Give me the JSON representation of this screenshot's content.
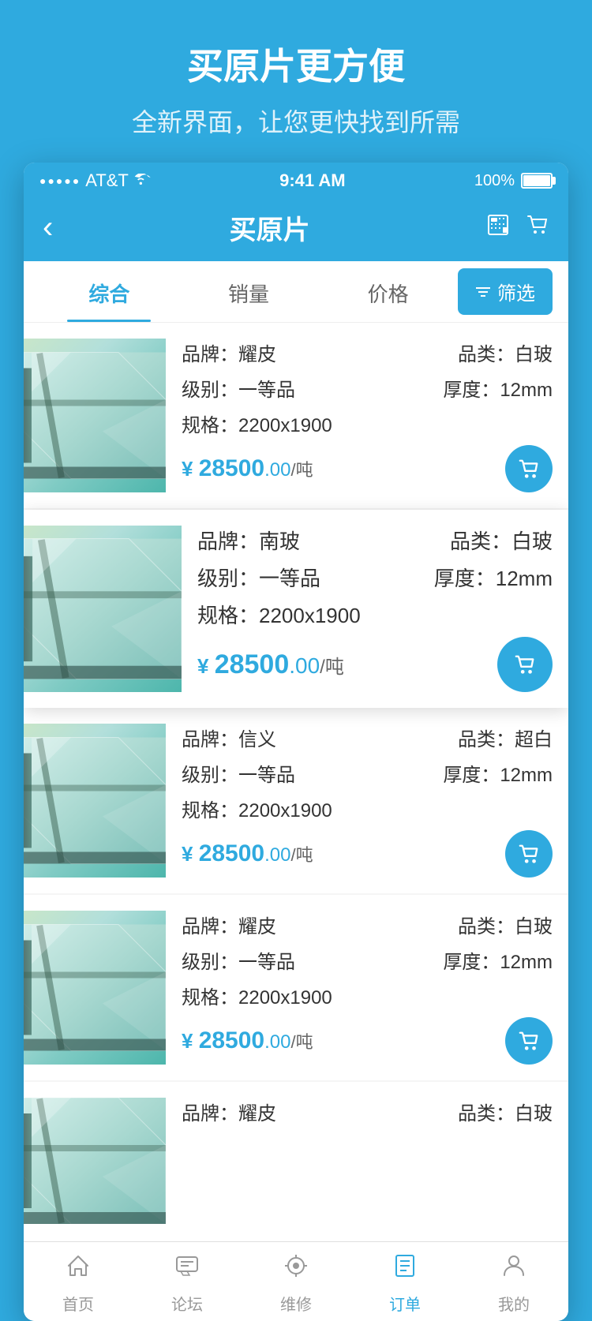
{
  "promo": {
    "title": "买原片更方便",
    "subtitle": "全新界面，让您更快找到所需"
  },
  "statusBar": {
    "carrier": "AT&T",
    "wifi": "wifi",
    "time": "9:41 AM",
    "battery": "100%"
  },
  "navBar": {
    "title": "买原片",
    "backLabel": "‹"
  },
  "tabs": [
    {
      "id": "comprehensive",
      "label": "综合",
      "active": true
    },
    {
      "id": "sales",
      "label": "销量",
      "active": false
    },
    {
      "id": "price",
      "label": "价格",
      "active": false
    }
  ],
  "filterBtn": "筛选",
  "products": [
    {
      "id": 1,
      "brand_label": "品牌：",
      "brand": "耀皮",
      "category_label": "品类：",
      "category": "白玻",
      "grade_label": "级别：",
      "grade": "一等品",
      "thickness_label": "厚度：",
      "thickness": "12mm",
      "spec_label": "规格：",
      "spec": "2200x1900",
      "price_symbol": "¥",
      "price_main": "28500",
      "price_cents": ".00",
      "price_unit": "/吨",
      "highlighted": false
    },
    {
      "id": 2,
      "brand_label": "品牌：",
      "brand": "南玻",
      "category_label": "品类：",
      "category": "白玻",
      "grade_label": "级别：",
      "grade": "一等品",
      "thickness_label": "厚度：",
      "thickness": "12mm",
      "spec_label": "规格：",
      "spec": "2200x1900",
      "price_symbol": "¥",
      "price_main": "28500",
      "price_cents": ".00",
      "price_unit": "/吨",
      "highlighted": true
    },
    {
      "id": 3,
      "brand_label": "品牌：",
      "brand": "信义",
      "category_label": "品类：",
      "category": "超白",
      "grade_label": "级别：",
      "grade": "一等品",
      "thickness_label": "厚度：",
      "thickness": "12mm",
      "spec_label": "规格：",
      "spec": "2200x1900",
      "price_symbol": "¥",
      "price_main": "28500",
      "price_cents": ".00",
      "price_unit": "/吨",
      "highlighted": false
    },
    {
      "id": 4,
      "brand_label": "品牌：",
      "brand": "耀皮",
      "category_label": "品类：",
      "category": "白玻",
      "grade_label": "级别：",
      "grade": "一等品",
      "thickness_label": "厚度：",
      "thickness": "12mm",
      "spec_label": "规格：",
      "spec": "2200x1900",
      "price_symbol": "¥",
      "price_main": "28500",
      "price_cents": ".00",
      "price_unit": "/吨",
      "highlighted": false
    },
    {
      "id": 5,
      "brand_label": "品牌：",
      "brand": "耀皮",
      "category_label": "品类：",
      "category": "白玻",
      "grade_label": "级别：",
      "grade": "",
      "thickness_label": "",
      "thickness": "",
      "spec_label": "",
      "spec": "",
      "price_symbol": "",
      "price_main": "",
      "price_cents": "",
      "price_unit": "",
      "highlighted": false,
      "partial": true
    }
  ],
  "bottomTabs": [
    {
      "id": "home",
      "label": "首页",
      "icon": "⌂",
      "active": false
    },
    {
      "id": "forum",
      "label": "论坛",
      "icon": "☰",
      "active": false
    },
    {
      "id": "repair",
      "label": "维修",
      "icon": "⚙",
      "active": false
    },
    {
      "id": "orders",
      "label": "订单",
      "icon": "≡",
      "active": true
    },
    {
      "id": "mine",
      "label": "我的",
      "icon": "👤",
      "active": false
    }
  ],
  "icons": {
    "cart": "🛒",
    "filter": "⊟",
    "back": "‹",
    "calculator": "⊞"
  }
}
